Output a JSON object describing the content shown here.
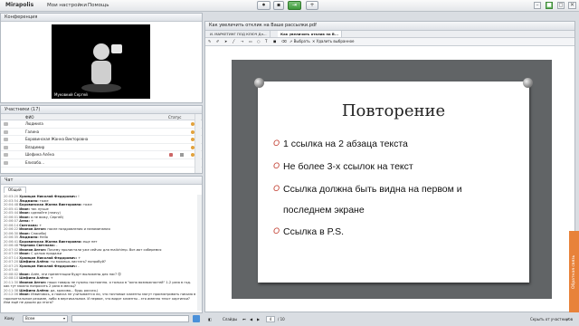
{
  "app": {
    "logo": "Mirapolis",
    "menu": [
      "Мои настройки",
      "Помощь"
    ]
  },
  "toolbar": {
    "mic_label": "⏺",
    "screen_label": "⇥",
    "add_label": "+"
  },
  "conference": {
    "title": "Конференция",
    "speaker_name": "Муковкий Сергей"
  },
  "participants": {
    "title": "Участники (17)",
    "columns": [
      "ФИО",
      "Статус"
    ],
    "rows": [
      "Людмила",
      "Галина",
      "Боровинская Жанна Викторовна",
      "Владимир",
      "Шефина Алёна",
      "Елизаба..."
    ]
  },
  "chat": {
    "title": "Чат",
    "subtab": "Общий",
    "lines": [
      {
        "time": "20:03:20",
        "author": "Храмцов Николай Федорович:",
        "text": "!"
      },
      {
        "time": "20:03:54",
        "author": "Людмила:",
        "text": "тоже"
      },
      {
        "time": "20:04:48",
        "author": "Боровинская Жанна Викторовна:",
        "text": "тоже"
      },
      {
        "time": "20:05:41",
        "author": "Иван:",
        "text": "так лучше"
      },
      {
        "time": "20:05:44",
        "author": "Иван:",
        "text": "сделайте (плачу)"
      },
      {
        "time": "20:06:01",
        "author": "Иван:",
        "text": "я не вижу, Сергей)"
      },
      {
        "time": "20:06:07",
        "author": "Анна:",
        "text": "+"
      },
      {
        "time": "20:06:14",
        "author": "Светлана:",
        "text": "+"
      },
      {
        "time": "20:06:22",
        "author": "Иванов Антон:",
        "text": "после поздравления и напоминания"
      },
      {
        "time": "20:06:30",
        "author": "Иван:",
        "text": "Спасибо)"
      },
      {
        "time": "20:06:35",
        "author": "Людмила:",
        "text": "Hello"
      },
      {
        "time": "20:06:41",
        "author": "Боровинская Жанна Викторовна:",
        "text": "еще нет"
      },
      {
        "time": "20:06:48",
        "author": "Чернова Светлана:",
        "text": "-"
      },
      {
        "time": "20:07:02",
        "author": "Иванов Антон:",
        "text": "Почему пролистали уже сейчас для mailchimp. Вот-вот соберемся"
      },
      {
        "time": "20:07:09",
        "author": "Иван:",
        "text": "С целью продажи"
      },
      {
        "time": "20:07:14",
        "author": "Храмцов Николай Федорович:",
        "text": "+"
      },
      {
        "time": "20:07:20",
        "author": "Шефина Алёна:",
        "text": "ты можешь листать? попробуй?"
      },
      {
        "time": "20:07:25",
        "author": "Храмцов Николай Федорович:",
        "text": "-"
      },
      {
        "time": "20:07:40",
        "author": "",
        "text": ""
      },
      {
        "time": "20:08:02",
        "author": "Иван:",
        "text": "Алён, эти презентации будут выложены для нас? 😊"
      },
      {
        "time": "20:08:10",
        "author": "Шефина Алёна:",
        "text": "+"
      },
      {
        "time": "20:11:30",
        "author": "Иванов Антон:",
        "text": "наши товары не нужны постоянно. я только в \"окно возможностей\" 1-2 раза в год. как тут можно попросить 2 раза в месяц?"
      },
      {
        "time": "20:11:38",
        "author": "Шефина Алёна:",
        "text": "да, красиво... будь россия-)"
      },
      {
        "time": "20:12:06",
        "author": "Иван:",
        "text": "Извиняюсь, а поиска не учитывается ли, что почтовые клиенты могут просматривать письмо в горизонтальном режиме, либо в вертикальном. И первое, что видят клиенты - это именно текст картинки? Или ещё не дошли до этого?"
      }
    ],
    "recipient_label": "Кому",
    "recipient_value": "Всем"
  },
  "document": {
    "tabs": [
      "Как увеличить отклик на Ваше рассылки.pdf"
    ],
    "subtabs": [
      "И. МАРКЕТИНГ ПОД КЛЮЧ Дл...",
      "Как увеличить отклик на В..."
    ],
    "tools": [
      "Выбрать",
      "Удалить выбранное"
    ],
    "page_label": "Слайды",
    "page_current": "4",
    "page_total": "/ 10",
    "hide_label": "Скрыть от участников",
    "side_tab": "Обратная связь"
  },
  "slide": {
    "title": "Повторение",
    "bullets": [
      "1 ссылка на 2 абзаца текста",
      "Не более 3-х ссылок на текст",
      "Ссылка должна быть видна на первом и",
      "последнем экране",
      "Ссылка в P.S."
    ]
  },
  "colors": {
    "accent": "#e8823a",
    "green": "#4fa84a",
    "bullet": "#c0392b",
    "slide_bg": "#616466"
  }
}
